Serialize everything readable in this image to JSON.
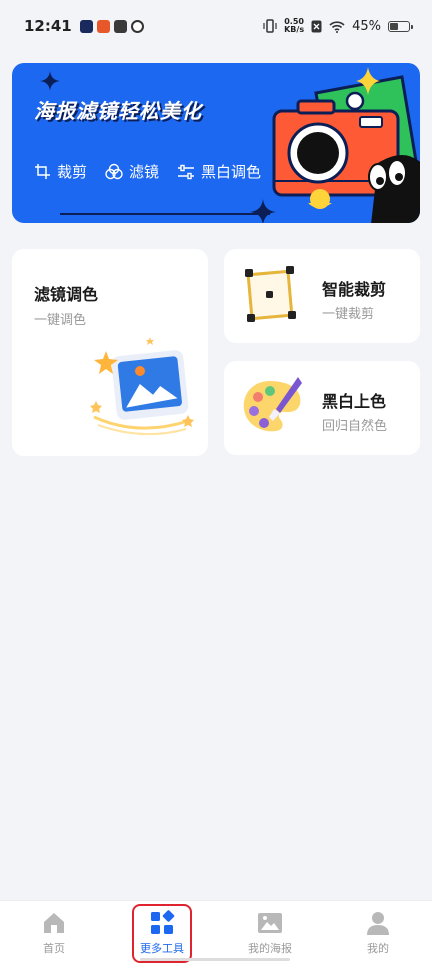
{
  "status": {
    "time": "12:41",
    "speed_value": "0.50",
    "speed_unit": "KB/s",
    "battery": "45%"
  },
  "banner": {
    "title": "海报滤镜轻松美化",
    "tools": [
      {
        "icon": "crop-icon",
        "label": "裁剪"
      },
      {
        "icon": "filter-icon",
        "label": "滤镜"
      },
      {
        "icon": "sliders-icon",
        "label": "黑白调色"
      }
    ]
  },
  "cards": {
    "filter": {
      "title": "滤镜调色",
      "subtitle": "一键调色"
    },
    "crop": {
      "title": "智能裁剪",
      "subtitle": "一键裁剪"
    },
    "colorize": {
      "title": "黑白上色",
      "subtitle": "回归自然色"
    }
  },
  "nav": [
    {
      "icon": "home-icon",
      "label": "首页",
      "active": false
    },
    {
      "icon": "grid-icon",
      "label": "更多工具",
      "active": true
    },
    {
      "icon": "image-icon",
      "label": "我的海报",
      "active": false
    },
    {
      "icon": "user-icon",
      "label": "我的",
      "active": false
    }
  ],
  "colors": {
    "accent": "#1d68f0",
    "highlight": "#e0242f",
    "background": "#f3f4f8"
  }
}
